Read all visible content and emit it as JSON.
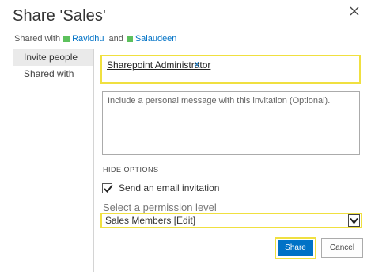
{
  "dialog": {
    "title": "Share 'Sales'",
    "close_icon": "close-icon"
  },
  "shared_with": {
    "prefix": "Shared with",
    "users": [
      "Ravidhu",
      "Salaudeen"
    ],
    "conjunction": "and",
    "presence_color": "#5dc15d"
  },
  "sidebar": {
    "items": [
      {
        "label": "Invite people",
        "active": true
      },
      {
        "label": "Shared with",
        "active": false
      }
    ]
  },
  "invite": {
    "resolved_user": "Sharepoint Administrator",
    "remove_label": "x",
    "message_placeholder": "Include a personal message with this invitation (Optional).",
    "hide_options_label": "HIDE OPTIONS",
    "send_email_label": "Send an email invitation",
    "send_email_checked": true,
    "permission_label": "Select a permission level",
    "permission_value": "Sales Members [Edit]"
  },
  "buttons": {
    "share": "Share",
    "cancel": "Cancel"
  },
  "colors": {
    "accent": "#0072c6",
    "highlight": "#f0e040"
  }
}
